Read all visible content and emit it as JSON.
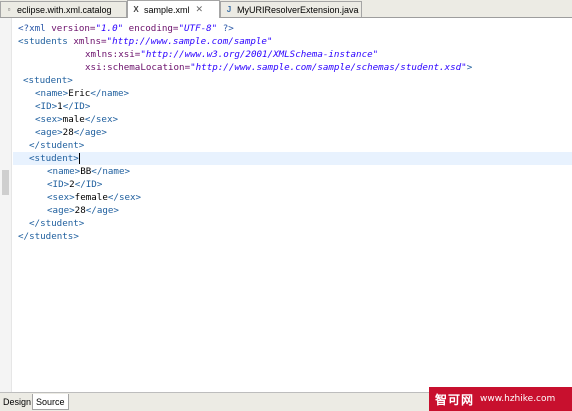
{
  "tabs": [
    {
      "label": "eclipse.with.xml.catalog",
      "icon": "file-icon",
      "active": false
    },
    {
      "label": "sample.xml",
      "icon": "xml-file-icon",
      "active": true
    },
    {
      "label": "MyURIResolverExtension.java",
      "icon": "java-file-icon",
      "active": false
    }
  ],
  "editor": {
    "xml_decl": {
      "open": "<?xml ",
      "version_attr": "version=",
      "version_val": "\"1.0\"",
      "encoding_attr": " encoding=",
      "encoding_val": "\"UTF-8\"",
      "close": " ?>"
    },
    "root_open": "<students ",
    "xmlns_attr": "xmlns=",
    "xmlns_val": "\"http://www.sample.com/sample\"",
    "xsi_attr": "xmlns:xsi=",
    "xsi_val": "\"http://www.w3.org/2001/XMLSchema-instance\"",
    "schema_attr": "xsi:schemaLocation=",
    "schema_val": "\"http://www.sample.com/sample/schemas/student.xsd\"",
    "root_open_end": ">",
    "student_open": "<student>",
    "student_close": "</student>",
    "root_close": "</students>",
    "students": [
      {
        "name": "Eric",
        "id": "1",
        "sex": "male",
        "age": "28"
      },
      {
        "name": "BB",
        "id": "2",
        "sex": "female",
        "age": "28"
      }
    ],
    "tags": {
      "name_open": "<name>",
      "name_close": "</name>",
      "id_open": "<ID>",
      "id_close": "</ID>",
      "sex_open": "<sex>",
      "sex_close": "</sex>",
      "age_open": "<age>",
      "age_close": "</age>"
    }
  },
  "bottom_tabs": [
    {
      "label": "Design",
      "active": false
    },
    {
      "label": "Source",
      "active": true
    }
  ],
  "watermark": {
    "cn": "智可网",
    "url": "www.hzhike.com"
  },
  "colors": {
    "tag": "#1f5f9e",
    "attr": "#6b0f6b",
    "value": "#2a00ff",
    "highlight_line": "#e8f2fe",
    "watermark_bg": "#c8102e"
  }
}
